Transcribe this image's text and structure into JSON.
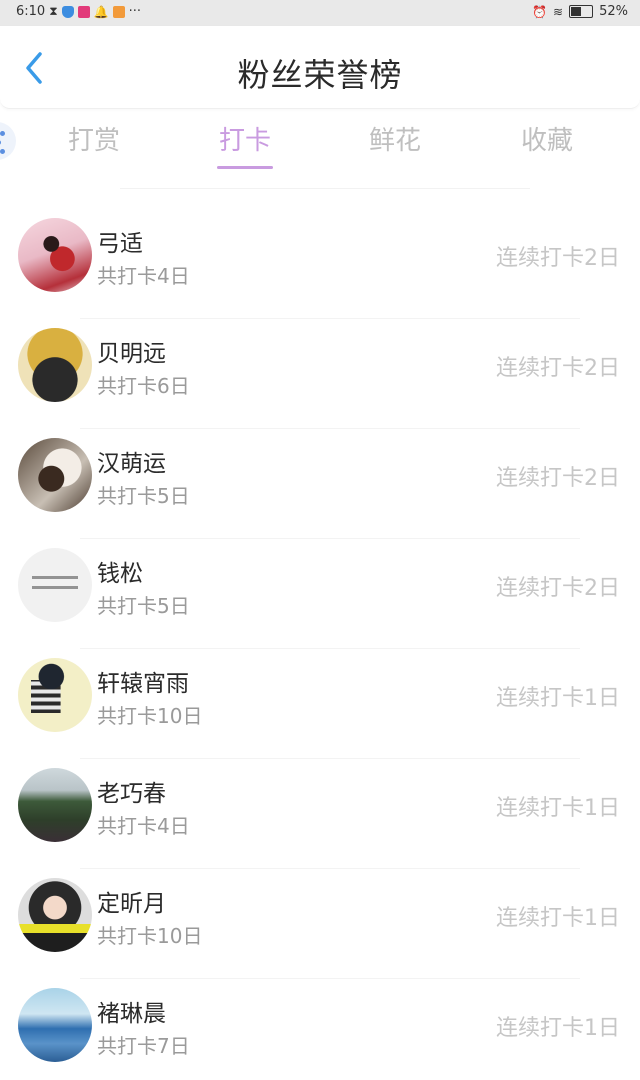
{
  "status_bar": {
    "time": "6:10",
    "battery": "52%",
    "more": "···"
  },
  "header": {
    "title": "粉丝荣誉榜"
  },
  "tabs": [
    {
      "label": "打赏"
    },
    {
      "label": "打卡"
    },
    {
      "label": "鲜花"
    },
    {
      "label": "收藏"
    }
  ],
  "active_tab": "打卡",
  "fans": [
    {
      "name": "弓适",
      "total": "共打卡4日",
      "streak": "连续打卡2日"
    },
    {
      "name": "贝明远",
      "total": "共打卡6日",
      "streak": "连续打卡2日"
    },
    {
      "name": "汉萌运",
      "total": "共打卡5日",
      "streak": "连续打卡2日"
    },
    {
      "name": "钱松",
      "total": "共打卡5日",
      "streak": "连续打卡2日"
    },
    {
      "name": "轩辕宵雨",
      "total": "共打卡10日",
      "streak": "连续打卡1日"
    },
    {
      "name": "老巧春",
      "total": "共打卡4日",
      "streak": "连续打卡1日"
    },
    {
      "name": "定昕月",
      "total": "共打卡10日",
      "streak": "连续打卡1日"
    },
    {
      "name": "褚琳晨",
      "total": "共打卡7日",
      "streak": "连续打卡1日"
    }
  ],
  "colors": {
    "accent": "#c99be0",
    "back_arrow": "#3a9be8",
    "muted_text": "#c6c6c6"
  }
}
